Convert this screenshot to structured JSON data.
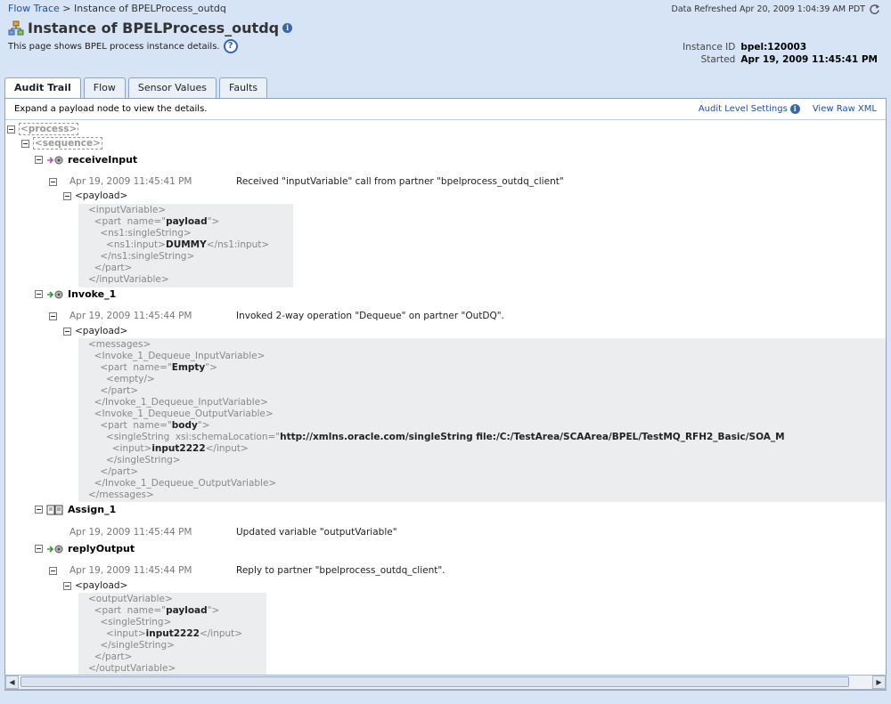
{
  "breadcrumb": {
    "link": "Flow Trace",
    "sep": ">",
    "current": "Instance of BPELProcess_outdq"
  },
  "refresh_text": "Data Refreshed Apr 20, 2009 1:04:39 AM PDT",
  "title": "Instance of BPELProcess_outdq",
  "subtitle": "This page shows BPEL process instance details.",
  "meta": {
    "id_label": "Instance ID",
    "id_value": "bpel:120003",
    "started_label": "Started",
    "started_value": "Apr 19, 2009 11:45:41 PM"
  },
  "tabs": [
    {
      "label": "Audit Trail",
      "active": true
    },
    {
      "label": "Flow"
    },
    {
      "label": "Sensor Values"
    },
    {
      "label": "Faults"
    }
  ],
  "panel": {
    "hint": "Expand a payload node to view the details.",
    "audit_link": "Audit Level Settings",
    "raw_link": "View Raw XML"
  },
  "tree": {
    "process": "<process>",
    "sequence": "<sequence>",
    "activities": [
      {
        "name": "receiveInput",
        "icon": "receive-icon",
        "time": "Apr 19, 2009 11:45:41 PM",
        "message": "Received \"inputVariable\" call from partner \"bpelprocess_outdq_client\"",
        "payload": "<payload>"
      },
      {
        "name": "Invoke_1",
        "icon": "invoke-icon",
        "time": "Apr 19, 2009 11:45:44 PM",
        "message": "Invoked 2-way operation \"Dequeue\" on partner \"OutDQ\".",
        "payload": "<payload>"
      },
      {
        "name": "Assign_1",
        "icon": "assign-icon",
        "time": "Apr 19, 2009 11:45:44 PM",
        "message": "Updated variable \"outputVariable\""
      },
      {
        "name": "replyOutput",
        "icon": "reply-icon",
        "time": "Apr 19, 2009 11:45:44 PM",
        "message": "Reply to partner \"bpelprocess_outdq_client\".",
        "payload": "<payload>"
      }
    ]
  },
  "xml": {
    "p1": [
      [
        "<inputVariable>"
      ],
      [
        "  <part  name=\"",
        "payload",
        "\">"
      ],
      [
        "    <ns1:singleString>"
      ],
      [
        "      <ns1:input>",
        "DUMMY",
        "</ns1:input>"
      ],
      [
        "    </ns1:singleString>"
      ],
      [
        "  </part>"
      ],
      [
        "</inputVariable>"
      ]
    ],
    "p2": [
      [
        "<messages>"
      ],
      [
        "  <Invoke_1_Dequeue_InputVariable>"
      ],
      [
        "    <part  name=\"",
        "Empty",
        "\">"
      ],
      [
        "      <empty/>"
      ],
      [
        "    </part>"
      ],
      [
        "  </Invoke_1_Dequeue_InputVariable>"
      ],
      [
        "  <Invoke_1_Dequeue_OutputVariable>"
      ],
      [
        "    <part  name=\"",
        "body",
        "\">"
      ],
      [
        "      <singleString  xsi:schemaLocation=\"",
        "http://xmlns.oracle.com/singleString file:/C:/TestArea/SCAArea/BPEL/TestMQ_RFH2_Basic/SOA_M",
        ""
      ],
      [
        "        <input>",
        "input2222",
        "</input>"
      ],
      [
        "      </singleString>"
      ],
      [
        "    </part>"
      ],
      [
        "  </Invoke_1_Dequeue_OutputVariable>"
      ],
      [
        "</messages>"
      ]
    ],
    "p3": [
      [
        "<outputVariable>"
      ],
      [
        "  <part  name=\"",
        "payload",
        "\">"
      ],
      [
        "    <singleString>"
      ],
      [
        "      <input>",
        "input2222",
        "</input>"
      ],
      [
        "    </singleString>"
      ],
      [
        "  </part>"
      ],
      [
        "</outputVariable>"
      ]
    ]
  }
}
